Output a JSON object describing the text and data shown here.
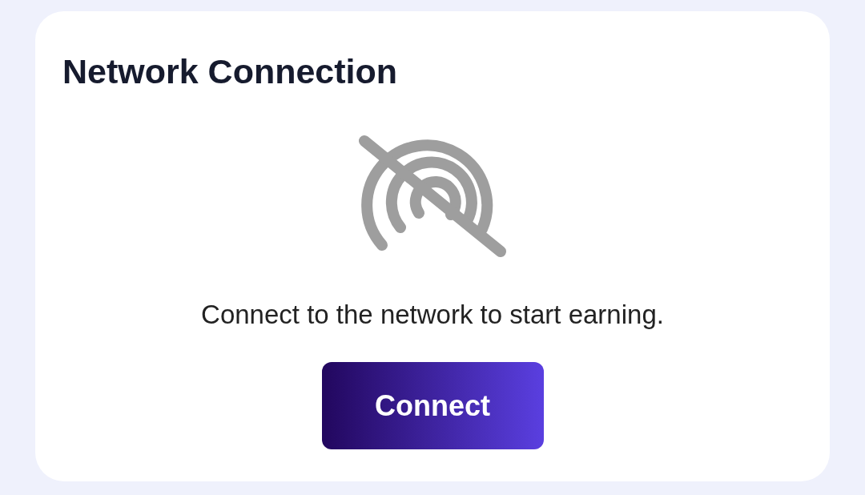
{
  "card": {
    "title": "Network Connection",
    "message": "Connect to the network to start earning.",
    "button": "Connect"
  }
}
